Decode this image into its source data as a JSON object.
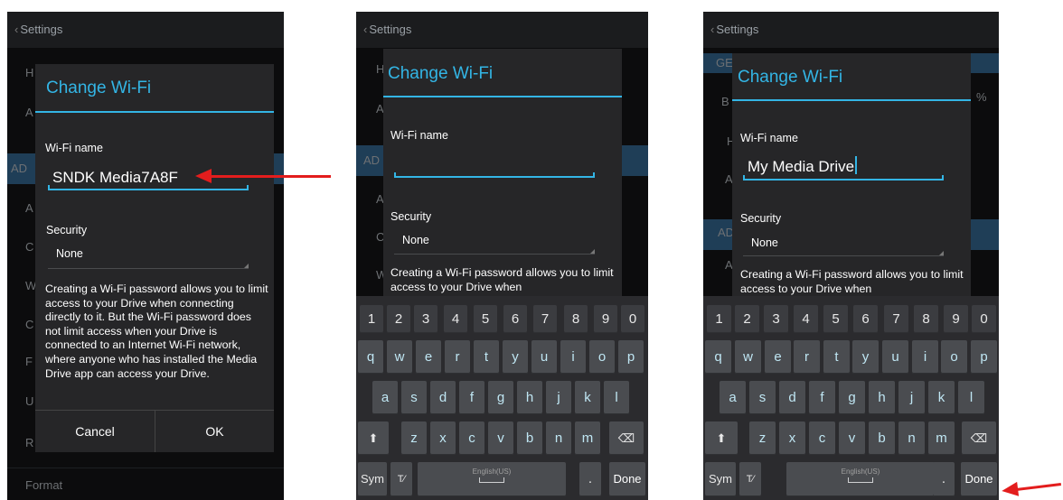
{
  "panel1": {
    "header": {
      "back_glyph": "‹",
      "title": "Settings"
    },
    "bg_letters": [
      "H",
      "A",
      "AD",
      "A",
      "C",
      "W",
      "C",
      "F",
      "U",
      "R"
    ],
    "format_label": "Format",
    "dialog": {
      "title": "Change Wi-Fi",
      "wifi_label": "Wi-Fi name",
      "wifi_value": "SNDK Media7A8F",
      "security_label": "Security",
      "security_value": "None",
      "description": "Creating a Wi-Fi password allows you to limit access to your Drive when connecting directly to it. But the Wi-Fi password does not limit access when your Drive is connected to an Internet Wi-Fi network, where anyone who has installed the Media Drive app can access your Drive.",
      "cancel": "Cancel",
      "ok": "OK"
    }
  },
  "panel2": {
    "header": {
      "back_glyph": "‹",
      "title": "Settings"
    },
    "bg_letters": [
      "H",
      "A",
      "AD",
      "A",
      "C",
      "W"
    ],
    "dialog": {
      "title": "Change Wi-Fi",
      "wifi_label": "Wi-Fi name",
      "wifi_value": "",
      "security_label": "Security",
      "security_value": "None",
      "description": "Creating a Wi-Fi password allows you to limit access to your Drive when"
    }
  },
  "panel3": {
    "header": {
      "back_glyph": "‹",
      "title": "Settings"
    },
    "bg_letters": [
      "GE",
      "B",
      "%",
      "H",
      "A",
      "AD",
      "A"
    ],
    "dialog": {
      "title": "Change Wi-Fi",
      "wifi_label": "Wi-Fi name",
      "wifi_value": "My Media Drive",
      "security_label": "Security",
      "security_value": "None",
      "description": "Creating a Wi-Fi password allows you to limit access to your Drive when"
    }
  },
  "keyboard": {
    "row_numbers": [
      "1",
      "2",
      "3",
      "4",
      "5",
      "6",
      "7",
      "8",
      "9",
      "0"
    ],
    "row_1": [
      "q",
      "w",
      "e",
      "r",
      "t",
      "y",
      "u",
      "i",
      "o",
      "p"
    ],
    "row_2": [
      "a",
      "s",
      "d",
      "f",
      "g",
      "h",
      "j",
      "k",
      "l"
    ],
    "row_3": [
      "z",
      "x",
      "c",
      "v",
      "b",
      "n",
      "m"
    ],
    "shift_glyph": "⬆",
    "backspace_glyph": "⌫",
    "sym": "Sym",
    "tool_glyph": "T⁄",
    "language": "English(US)",
    "period": ".",
    "done": "Done"
  },
  "colors": {
    "accent": "#33b5e5",
    "annotation_arrow": "#e31d1d",
    "screen_bg": "#0c0c0d"
  }
}
